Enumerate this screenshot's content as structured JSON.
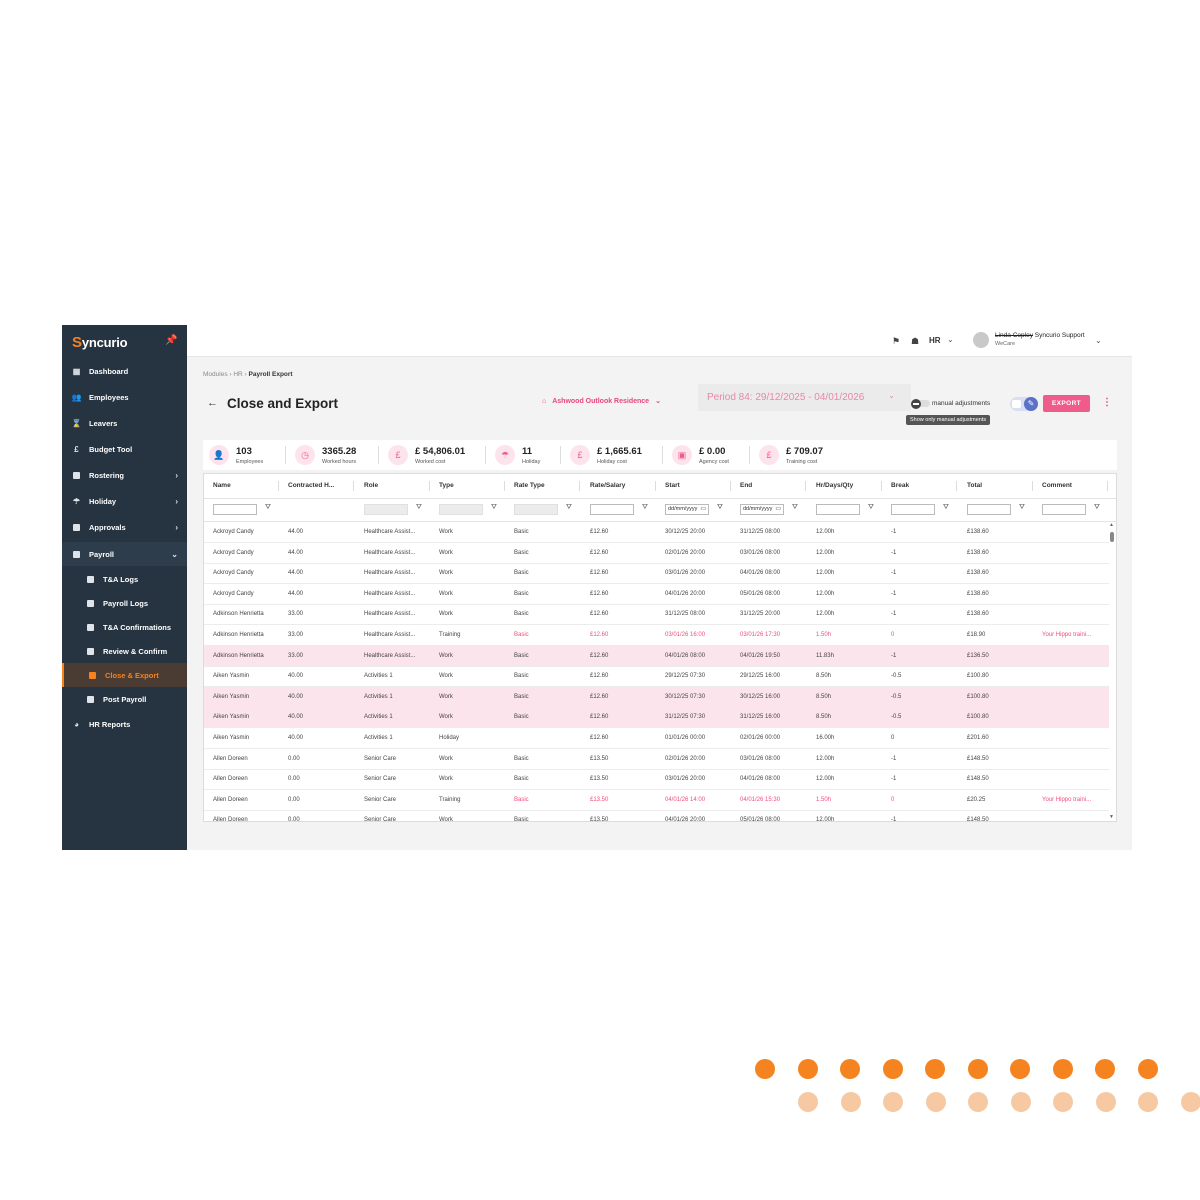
{
  "app": {
    "logo_s": "S",
    "logo_rest": "yncurio"
  },
  "sidebar": {
    "items": [
      {
        "label": "Dashboard"
      },
      {
        "label": "Employees"
      },
      {
        "label": "Leavers"
      },
      {
        "label": "Budget Tool"
      },
      {
        "label": "Rostering"
      },
      {
        "label": "Holiday"
      },
      {
        "label": "Approvals"
      },
      {
        "label": "Payroll"
      },
      {
        "label": "T&A Logs"
      },
      {
        "label": "Payroll Logs"
      },
      {
        "label": "T&A Confirmations"
      },
      {
        "label": "Review & Confirm"
      },
      {
        "label": "Close & Export"
      },
      {
        "label": "Post Payroll"
      },
      {
        "label": "HR Reports"
      }
    ]
  },
  "topbar": {
    "hr_label": "HR",
    "user_name_struck": "Linda Copley",
    "user_name": "Syncurio Support",
    "user_org": "WeCare"
  },
  "breadcrumb": {
    "part1": "Modules",
    "part2": "HR",
    "current": "Payroll Export"
  },
  "header": {
    "title": "Close and Export",
    "location": "Ashwood Outlook Residence",
    "period": "Period 84: 29/12/2025 - 04/01/2026",
    "manual_adjustments": "manual adjustments",
    "tooltip": "Show only manual adjustments",
    "export_label": "EXPORT"
  },
  "stats": [
    {
      "value": "103",
      "label": "Employees",
      "icon": "person-icon",
      "glyph": "👤"
    },
    {
      "value": "3365.28",
      "label": "Worked hours",
      "icon": "clock-icon",
      "glyph": "◷"
    },
    {
      "value": "£ 54,806.01",
      "label": "Worked cost",
      "icon": "pound-icon",
      "glyph": "£"
    },
    {
      "value": "11",
      "label": "Holiday",
      "icon": "beach-umbrella-icon",
      "glyph": "☂"
    },
    {
      "value": "£ 1,665.61",
      "label": "Holiday cost",
      "icon": "pound-icon",
      "glyph": "£"
    },
    {
      "value": "£ 0.00",
      "label": "Agency cost",
      "icon": "briefcase-icon",
      "glyph": "▣"
    },
    {
      "value": "£ 709.07",
      "label": "Training cost",
      "icon": "pound-icon",
      "glyph": "£"
    }
  ],
  "table": {
    "columns": [
      "Name",
      "Contracted H...",
      "Role",
      "Type",
      "Rate Type",
      "Rate/Salary",
      "Start",
      "End",
      "Hr/Days/Qty",
      "Break",
      "Total",
      "Comment"
    ],
    "date_placeholder": "dd/mm/yyyy",
    "rows": [
      {
        "name": "Ackroyd Candy",
        "contracted": "44.00",
        "role": "Healthcare Assist...",
        "type": "Work",
        "rate_type": "Basic",
        "rate": "£12.60",
        "start": "30/12/25 20:00",
        "end": "31/12/25 08:00",
        "qty": "12.00h",
        "brk": "-1",
        "total": "£138.60",
        "comment": "",
        "hl": false,
        "red": false
      },
      {
        "name": "Ackroyd Candy",
        "contracted": "44.00",
        "role": "Healthcare Assist...",
        "type": "Work",
        "rate_type": "Basic",
        "rate": "£12.60",
        "start": "02/01/26 20:00",
        "end": "03/01/26 08:00",
        "qty": "12.00h",
        "brk": "-1",
        "total": "£138.60",
        "comment": "",
        "hl": false,
        "red": false
      },
      {
        "name": "Ackroyd Candy",
        "contracted": "44.00",
        "role": "Healthcare Assist...",
        "type": "Work",
        "rate_type": "Basic",
        "rate": "£12.60",
        "start": "03/01/26 20:00",
        "end": "04/01/26 08:00",
        "qty": "12.00h",
        "brk": "-1",
        "total": "£138.60",
        "comment": "",
        "hl": false,
        "red": false
      },
      {
        "name": "Ackroyd Candy",
        "contracted": "44.00",
        "role": "Healthcare Assist...",
        "type": "Work",
        "rate_type": "Basic",
        "rate": "£12.60",
        "start": "04/01/26 20:00",
        "end": "05/01/26 08:00",
        "qty": "12.00h",
        "brk": "-1",
        "total": "£138.60",
        "comment": "",
        "hl": false,
        "red": false
      },
      {
        "name": "Adkinson Henrietta",
        "contracted": "33.00",
        "role": "Healthcare Assist...",
        "type": "Work",
        "rate_type": "Basic",
        "rate": "£12.60",
        "start": "31/12/25 08:00",
        "end": "31/12/25 20:00",
        "qty": "12.00h",
        "brk": "-1",
        "total": "£138.60",
        "comment": "",
        "hl": false,
        "red": false
      },
      {
        "name": "Adkinson Henrietta",
        "contracted": "33.00",
        "role": "Healthcare Assist...",
        "type": "Training",
        "rate_type": "Basic",
        "rate": "£12.60",
        "start": "03/01/26 16:00",
        "end": "03/01/26 17:30",
        "qty": "1.50h",
        "brk": "0",
        "total": "£18.90",
        "comment": "Your Hippo traini...",
        "hl": false,
        "red": true
      },
      {
        "name": "Adkinson Henrietta",
        "contracted": "33.00",
        "role": "Healthcare Assist...",
        "type": "Work",
        "rate_type": "Basic",
        "rate": "£12.60",
        "start": "04/01/26 08:00",
        "end": "04/01/26 19:50",
        "qty": "11.83h",
        "brk": "-1",
        "total": "£136.50",
        "comment": "",
        "hl": true,
        "red": false
      },
      {
        "name": "Aiken Yasmin",
        "contracted": "40.00",
        "role": "Activities 1",
        "type": "Work",
        "rate_type": "Basic",
        "rate": "£12.60",
        "start": "29/12/25 07:30",
        "end": "29/12/25 16:00",
        "qty": "8.50h",
        "brk": "-0.5",
        "total": "£100.80",
        "comment": "",
        "hl": false,
        "red": false
      },
      {
        "name": "Aiken Yasmin",
        "contracted": "40.00",
        "role": "Activities 1",
        "type": "Work",
        "rate_type": "Basic",
        "rate": "£12.60",
        "start": "30/12/25 07:30",
        "end": "30/12/25 16:00",
        "qty": "8.50h",
        "brk": "-0.5",
        "total": "£100.80",
        "comment": "",
        "hl": true,
        "red": false
      },
      {
        "name": "Aiken Yasmin",
        "contracted": "40.00",
        "role": "Activities 1",
        "type": "Work",
        "rate_type": "Basic",
        "rate": "£12.60",
        "start": "31/12/25 07:30",
        "end": "31/12/25 16:00",
        "qty": "8.50h",
        "brk": "-0.5",
        "total": "£100.80",
        "comment": "",
        "hl": true,
        "red": false
      },
      {
        "name": "Aiken Yasmin",
        "contracted": "40.00",
        "role": "Activities 1",
        "type": "Holiday",
        "rate_type": "",
        "rate": "£12.60",
        "start": "01/01/26 00:00",
        "end": "02/01/26 00:00",
        "qty": "16.00h",
        "brk": "0",
        "total": "£201.60",
        "comment": "",
        "hl": false,
        "red": false
      },
      {
        "name": "Allen Doreen",
        "contracted": "0.00",
        "role": "Senior Care",
        "type": "Work",
        "rate_type": "Basic",
        "rate": "£13.50",
        "start": "02/01/26 20:00",
        "end": "03/01/26 08:00",
        "qty": "12.00h",
        "brk": "-1",
        "total": "£148.50",
        "comment": "",
        "hl": false,
        "red": false
      },
      {
        "name": "Allen Doreen",
        "contracted": "0.00",
        "role": "Senior Care",
        "type": "Work",
        "rate_type": "Basic",
        "rate": "£13.50",
        "start": "03/01/26 20:00",
        "end": "04/01/26 08:00",
        "qty": "12.00h",
        "brk": "-1",
        "total": "£148.50",
        "comment": "",
        "hl": false,
        "red": false
      },
      {
        "name": "Allen Doreen",
        "contracted": "0.00",
        "role": "Senior Care",
        "type": "Training",
        "rate_type": "Basic",
        "rate": "£13.50",
        "start": "04/01/26 14:00",
        "end": "04/01/26 15:30",
        "qty": "1.50h",
        "brk": "0",
        "total": "£20.25",
        "comment": "Your Hippo traini...",
        "hl": false,
        "red": true
      },
      {
        "name": "Allen Doreen",
        "contracted": "0.00",
        "role": "Senior Care",
        "type": "Work",
        "rate_type": "Basic",
        "rate": "£13.50",
        "start": "04/01/26 20:00",
        "end": "05/01/26 08:00",
        "qty": "12.00h",
        "brk": "-1",
        "total": "£148.50",
        "comment": "",
        "hl": false,
        "red": false
      }
    ]
  },
  "colors": {
    "accent": "#ef5c8c",
    "brand_orange": "#f5831f",
    "sidebar_bg": "#263340",
    "dot_orange": "#f5831f",
    "dot_peach": "#f7c9a3"
  }
}
